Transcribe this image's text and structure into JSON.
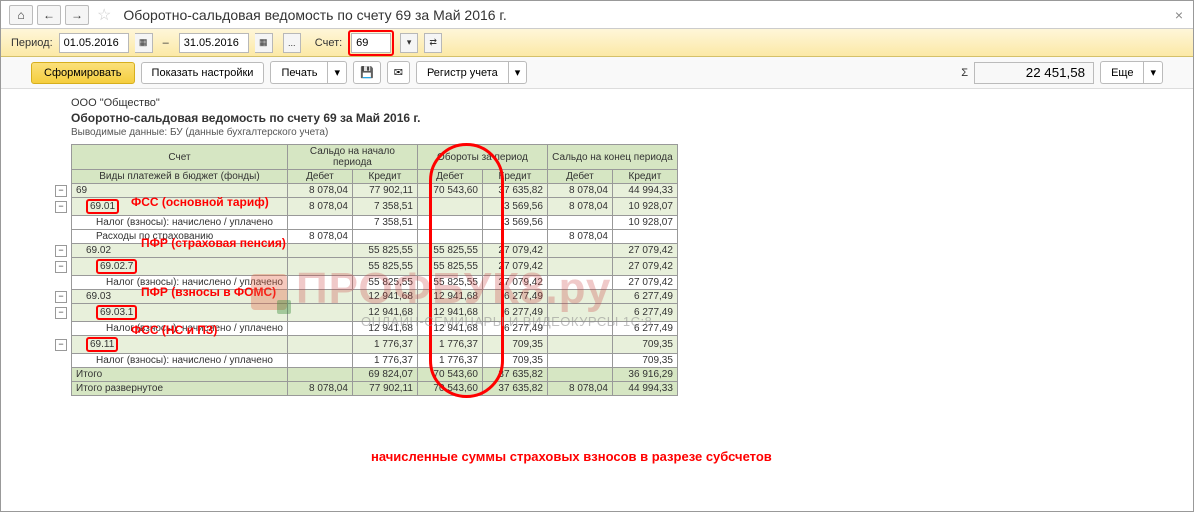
{
  "titlebar": {
    "title": "Оборотно-сальдовая ведомость по счету 69 за Май 2016 г."
  },
  "params": {
    "period_label": "Период:",
    "date_from": "01.05.2016",
    "date_to": "31.05.2016",
    "account_label": "Счет:",
    "account": "69"
  },
  "toolbar": {
    "form": "Сформировать",
    "show_settings": "Показать настройки",
    "print": "Печать",
    "register": "Регистр учета",
    "more": "Еще",
    "sigma": "Σ",
    "sum_value": "22 451,58"
  },
  "report": {
    "org": "ООО \"Общество\"",
    "title": "Оборотно-сальдовая ведомость по счету 69 за Май 2016 г.",
    "sub": "Выводимые данные: БУ (данные бухгалтерского учета)"
  },
  "headers": {
    "account": "Счет",
    "payments": "Виды платежей в бюджет (фонды)",
    "period_start": "Сальдо на начало периода",
    "turnover": "Обороты за период",
    "period_end": "Сальдо на конец периода",
    "debit": "Дебет",
    "credit": "Кредит"
  },
  "rows": [
    {
      "acct": "69",
      "indent": 0,
      "green": true,
      "d1": "8 078,04",
      "c1": "77 902,11",
      "d2": "70 543,60",
      "c2": "37 635,82",
      "d3": "8 078,04",
      "c3": "44 994,33"
    },
    {
      "acct": "69.01",
      "indent": 1,
      "green": true,
      "hl": true,
      "d1": "8 078,04",
      "c1": "7 358,51",
      "d2": "",
      "c2": "3 569,56",
      "d3": "8 078,04",
      "c3": "10 928,07"
    },
    {
      "acct": "Налог (взносы): начислено / уплачено",
      "indent": 2,
      "d1": "",
      "c1": "7 358,51",
      "d2": "",
      "c2": "3 569,56",
      "d3": "",
      "c3": "10 928,07"
    },
    {
      "acct": "Расходы по страхованию",
      "indent": 2,
      "d1": "8 078,04",
      "c1": "",
      "d2": "",
      "c2": "",
      "d3": "8 078,04",
      "c3": ""
    },
    {
      "acct": "69.02",
      "indent": 1,
      "green": true,
      "d1": "",
      "c1": "55 825,55",
      "d2": "55 825,55",
      "c2": "27 079,42",
      "d3": "",
      "c3": "27 079,42"
    },
    {
      "acct": "69.02.7",
      "indent": 2,
      "green": true,
      "hl": true,
      "d1": "",
      "c1": "55 825,55",
      "d2": "55 825,55",
      "c2": "27 079,42",
      "d3": "",
      "c3": "27 079,42"
    },
    {
      "acct": "Налог (взносы): начислено / уплачено",
      "indent": 3,
      "d1": "",
      "c1": "55 825,55",
      "d2": "55 825,55",
      "c2": "27 079,42",
      "d3": "",
      "c3": "27 079,42"
    },
    {
      "acct": "69.03",
      "indent": 1,
      "green": true,
      "d1": "",
      "c1": "12 941,68",
      "d2": "12 941,68",
      "c2": "6 277,49",
      "d3": "",
      "c3": "6 277,49"
    },
    {
      "acct": "69.03.1",
      "indent": 2,
      "green": true,
      "hl": true,
      "d1": "",
      "c1": "12 941,68",
      "d2": "12 941,68",
      "c2": "6 277,49",
      "d3": "",
      "c3": "6 277,49"
    },
    {
      "acct": "Налог (взносы): начислено / уплачено",
      "indent": 3,
      "d1": "",
      "c1": "12 941,68",
      "d2": "12 941,68",
      "c2": "6 277,49",
      "d3": "",
      "c3": "6 277,49"
    },
    {
      "acct": "69.11",
      "indent": 1,
      "green": true,
      "hl": true,
      "d1": "",
      "c1": "1 776,37",
      "d2": "1 776,37",
      "c2": "709,35",
      "d3": "",
      "c3": "709,35"
    },
    {
      "acct": "Налог (взносы): начислено / уплачено",
      "indent": 2,
      "d1": "",
      "c1": "1 776,37",
      "d2": "1 776,37",
      "c2": "709,35",
      "d3": "",
      "c3": "709,35"
    },
    {
      "acct": "Итого",
      "total": true,
      "d1": "",
      "c1": "69 824,07",
      "d2": "70 543,60",
      "c2": "37 635,82",
      "d3": "",
      "c3": "36 916,29"
    },
    {
      "acct": "Итого развернутое",
      "total": true,
      "d1": "8 078,04",
      "c1": "77 902,11",
      "d2": "70 543,60",
      "c2": "37 635,82",
      "d3": "8 078,04",
      "c3": "44 994,33"
    }
  ],
  "annotations": {
    "a1": "ФСС (основной тариф)",
    "a2": "ПФР (страховая пенсия)",
    "a3": "ПФР (взносы в ФОМС)",
    "a4": "ФСС (НС и ПЗ)",
    "bottom": "начисленные суммы страховых взносов в разрезе субсчетов"
  },
  "watermark": {
    "main": "ПРОФБУК8.ру",
    "sub": "ОНЛАЙН-СЕМИНАРЫ И ВИДЕОКУРСЫ 1С:8"
  }
}
